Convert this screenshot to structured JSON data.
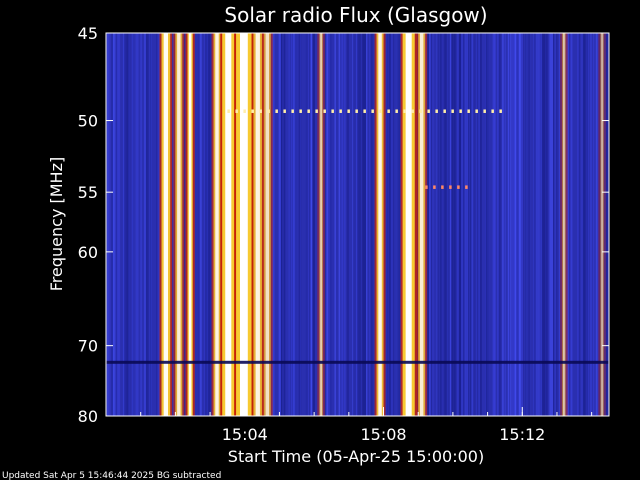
{
  "chart_data": {
    "type": "heatmap",
    "title": "Solar radio Flux (Glasgow)",
    "xlabel": "Start Time (05-Apr-25 15:00:00)",
    "ylabel": "Frequency [MHz]",
    "x_tick_labels": [
      "15:04",
      "15:08",
      "15:12"
    ],
    "x_ticks_minutes": [
      4,
      8,
      12
    ],
    "xlim_minutes": [
      0,
      14.5
    ],
    "y_tick_labels": [
      "45",
      "50",
      "55",
      "60",
      "70",
      "80"
    ],
    "y_ticks_mhz": [
      45,
      50,
      55,
      60,
      70,
      80
    ],
    "ylim_mhz": [
      45,
      80
    ],
    "y_scale": "reciprocal",
    "background_color": "#2a2fb0",
    "bursts": [
      {
        "t_start": 1.6,
        "t_end": 1.85,
        "intensity": 0.95
      },
      {
        "t_start": 2.0,
        "t_end": 2.2,
        "intensity": 0.8
      },
      {
        "t_start": 2.35,
        "t_end": 2.5,
        "intensity": 1.0
      },
      {
        "t_start": 3.1,
        "t_end": 3.3,
        "intensity": 0.85
      },
      {
        "t_start": 3.35,
        "t_end": 3.7,
        "intensity": 1.0
      },
      {
        "t_start": 3.75,
        "t_end": 4.2,
        "intensity": 1.0
      },
      {
        "t_start": 4.25,
        "t_end": 4.5,
        "intensity": 0.85
      },
      {
        "t_start": 4.55,
        "t_end": 4.75,
        "intensity": 0.7
      },
      {
        "t_start": 6.15,
        "t_end": 6.25,
        "intensity": 0.6
      },
      {
        "t_start": 7.8,
        "t_end": 8.0,
        "intensity": 0.9
      },
      {
        "t_start": 8.55,
        "t_end": 8.9,
        "intensity": 1.0
      },
      {
        "t_start": 9.0,
        "t_end": 9.2,
        "intensity": 0.8
      },
      {
        "t_start": 13.15,
        "t_end": 13.25,
        "intensity": 0.55
      },
      {
        "t_start": 14.25,
        "t_end": 14.35,
        "intensity": 0.45
      }
    ],
    "interference_mhz": [
      49.4,
      54.6
    ],
    "footer_text": "Updated Sat Apr  5 15:46:44 2025   BG subtracted",
    "colors": {
      "axis": "#ffffff",
      "bg": "#000000",
      "hot": "#ffffff",
      "warm": "#ffdd33",
      "mid": "#cc2200"
    }
  }
}
